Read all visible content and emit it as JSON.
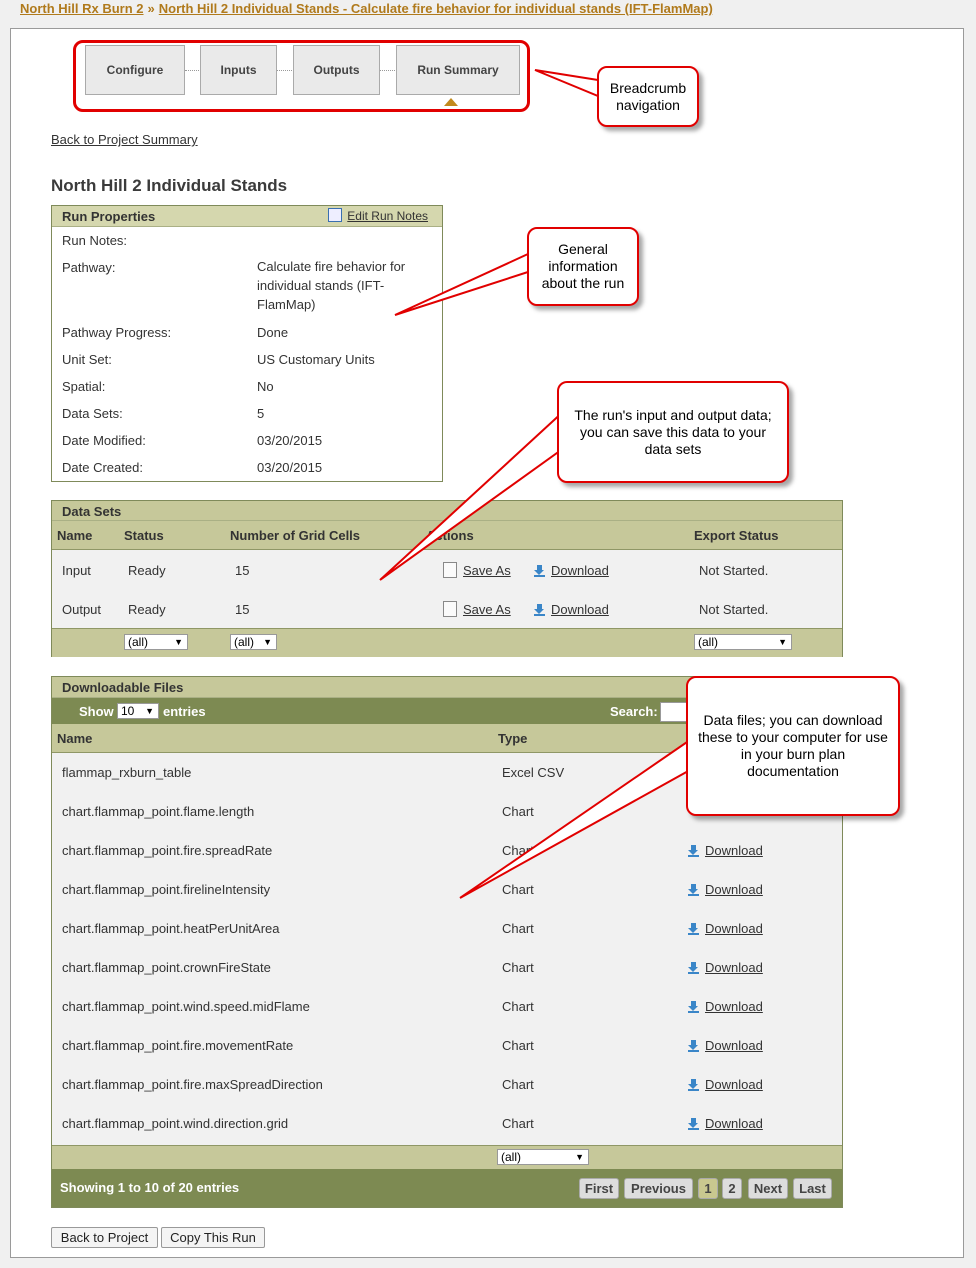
{
  "breadcrumb": {
    "items": [
      "North Hill Rx Burn 2",
      "North Hill 2 Individual Stands - Calculate fire behavior for individual stands (IFT-FlamMap)"
    ],
    "separator": "»"
  },
  "steps": [
    "Configure",
    "Inputs",
    "Outputs",
    "Run Summary"
  ],
  "back_to_summary": "Back to Project Summary",
  "page_title": "North Hill 2 Individual Stands",
  "run_properties": {
    "heading": "Run Properties",
    "edit_label": "Edit Run Notes",
    "rows": [
      {
        "label": "Run Notes:",
        "value": ""
      },
      {
        "label": "Pathway:",
        "value": "Calculate fire behavior for individual stands (IFT-FlamMap)"
      },
      {
        "label": "Pathway Progress:",
        "value": "Done"
      },
      {
        "label": "Unit Set:",
        "value": "US Customary Units"
      },
      {
        "label": "Spatial:",
        "value": "No"
      },
      {
        "label": "Data Sets:",
        "value": "5"
      },
      {
        "label": "Date Modified:",
        "value": "03/20/2015"
      },
      {
        "label": "Date Created:",
        "value": "03/20/2015"
      }
    ]
  },
  "data_sets": {
    "heading": "Data Sets",
    "columns": [
      "Name",
      "Status",
      "Number of Grid Cells",
      "Actions",
      "Export Status"
    ],
    "rows": [
      {
        "name": "Input",
        "status": "Ready",
        "cells": "15",
        "save": "Save As",
        "download": "Download",
        "export": "Not Started."
      },
      {
        "name": "Output",
        "status": "Ready",
        "cells": "15",
        "save": "Save As",
        "download": "Download",
        "export": "Not Started."
      }
    ],
    "filters": [
      "(all)",
      "(all)",
      "(all)"
    ]
  },
  "downloadable_files": {
    "heading": "Downloadable Files",
    "show_label": "Show",
    "entries_value": "10",
    "entries_label": "entries",
    "search_label": "Search:",
    "columns": [
      "Name",
      "Type"
    ],
    "rows": [
      {
        "name": "flammap_rxburn_table",
        "type": "Excel CSV",
        "download": ""
      },
      {
        "name": "chart.flammap_point.flame.length",
        "type": "Chart",
        "download": ""
      },
      {
        "name": "chart.flammap_point.fire.spreadRate",
        "type": "Chart",
        "download": "Download"
      },
      {
        "name": "chart.flammap_point.firelineIntensity",
        "type": "Chart",
        "download": "Download"
      },
      {
        "name": "chart.flammap_point.heatPerUnitArea",
        "type": "Chart",
        "download": "Download"
      },
      {
        "name": "chart.flammap_point.crownFireState",
        "type": "Chart",
        "download": "Download"
      },
      {
        "name": "chart.flammap_point.wind.speed.midFlame",
        "type": "Chart",
        "download": "Download"
      },
      {
        "name": "chart.flammap_point.fire.movementRate",
        "type": "Chart",
        "download": "Download"
      },
      {
        "name": "chart.flammap_point.fire.maxSpreadDirection",
        "type": "Chart",
        "download": "Download"
      },
      {
        "name": "chart.flammap_point.wind.direction.grid",
        "type": "Chart",
        "download": "Download"
      }
    ],
    "type_filter": "(all)",
    "info": "Showing 1 to 10 of 20 entries",
    "pagination": [
      "First",
      "Previous",
      "1",
      "2",
      "Next",
      "Last"
    ]
  },
  "buttons": {
    "back": "Back to Project",
    "copy": "Copy This Run"
  },
  "callouts": {
    "breadcrumb": "Breadcrumb navigation",
    "general": "General information about the run",
    "datasets": "The run's input and output data; you can save this data to your data sets",
    "files": "Data files; you can download these to your computer for use in your burn plan documentation"
  },
  "colors": {
    "accent_link": "#b07a1c",
    "callout_border": "#e10000",
    "olive_header": "#c6c89a",
    "dark_olive": "#7d8a52"
  }
}
